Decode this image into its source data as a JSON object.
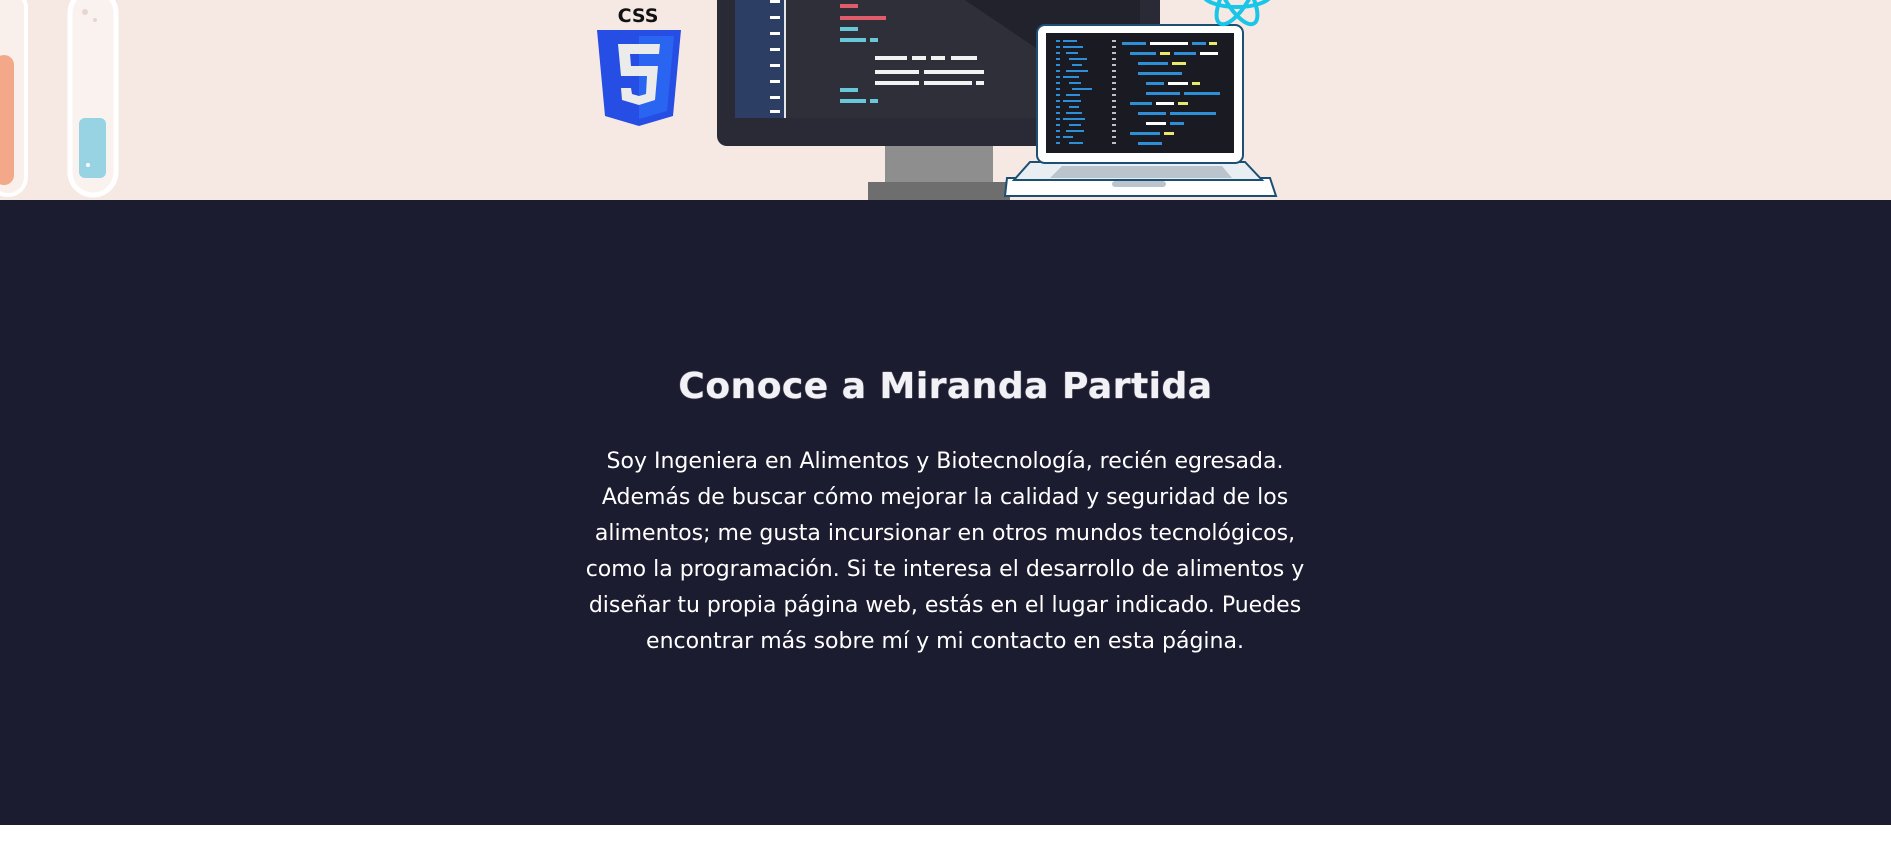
{
  "hero": {
    "css_badge": "CSS",
    "illustrations": [
      "test-tubes-icon",
      "css3-icon",
      "monitor-code-icon",
      "laptop-code-icon",
      "react-logo-icon"
    ],
    "background_color": "#f6e9e4"
  },
  "about": {
    "title": "Conoce a Miranda Partida",
    "description": "Soy Ingeniera en Alimentos y Biotecnología, recién egresada. Además de buscar cómo mejorar la calidad y seguridad de los alimentos; me gusta incursionar en otros mundos tecnológicos, como la programación. Si te interesa el desarrollo de alimentos y diseñar tu propia página web, estás en el lugar indicado. Puedes encontrar más sobre mí y mi contacto en esta página.",
    "background_color": "#1c1c30",
    "text_color": "#ffffff"
  }
}
